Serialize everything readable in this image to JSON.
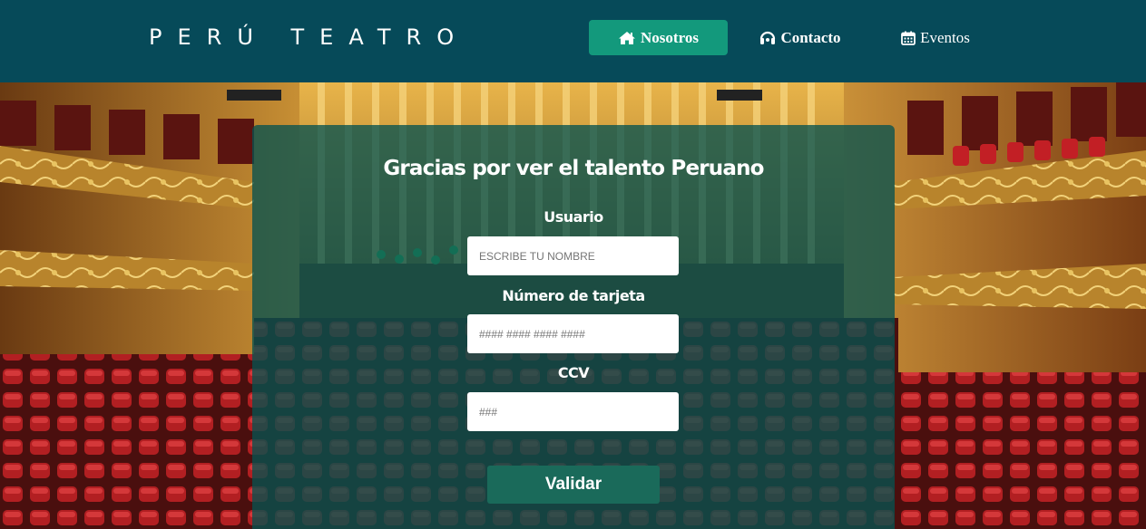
{
  "brand": {
    "title": "PERÚ TEATRO"
  },
  "nav": {
    "items": [
      {
        "label": "Nosotros",
        "icon": "home-icon",
        "active": true
      },
      {
        "label": "Contacto",
        "icon": "headset-icon",
        "active": false
      },
      {
        "label": "Eventos",
        "icon": "calendar-icon",
        "active": false
      }
    ]
  },
  "form": {
    "title": "Gracias por ver el talento Peruano",
    "fields": [
      {
        "label": "Usuario",
        "placeholder": "ESCRIBE TU NOMBRE",
        "value": ""
      },
      {
        "label": "Número de tarjeta",
        "placeholder": "#### #### #### ####",
        "value": ""
      },
      {
        "label": "CCV",
        "placeholder": "###",
        "value": ""
      }
    ],
    "submit_label": "Validar"
  },
  "colors": {
    "header_bg": "#064a59",
    "nav_active_bg": "#13997c",
    "panel_bg": "#065250",
    "button_bg": "#1a6a5a"
  }
}
